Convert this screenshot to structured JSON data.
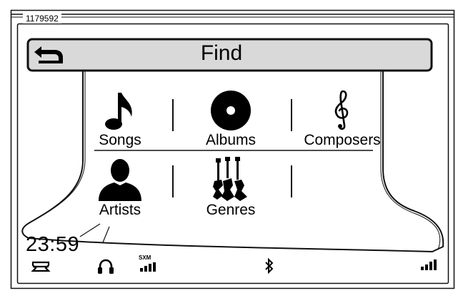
{
  "figure": {
    "reference_number": "1179592"
  },
  "screen": {
    "title": "Find",
    "back_icon": "back-arrow-icon"
  },
  "menu": {
    "items": [
      {
        "label": "Songs",
        "icon": "music-note-icon"
      },
      {
        "label": "Albums",
        "icon": "disc-icon"
      },
      {
        "label": "Composers",
        "icon": "treble-clef-icon"
      },
      {
        "label": "Artists",
        "icon": "person-silhouette-icon"
      },
      {
        "label": "Genres",
        "icon": "guitars-icon"
      }
    ]
  },
  "status_bar": {
    "time": "23:59",
    "sxm_label": "SXM",
    "icons": [
      "harley-logo-icon",
      "headphones-icon",
      "sxm-signal-icon",
      "bluetooth-icon",
      "cell-signal-icon"
    ]
  },
  "colors": {
    "title_bar_fill": "#d9d9d9",
    "line": "#111111",
    "background": "#ffffff"
  }
}
